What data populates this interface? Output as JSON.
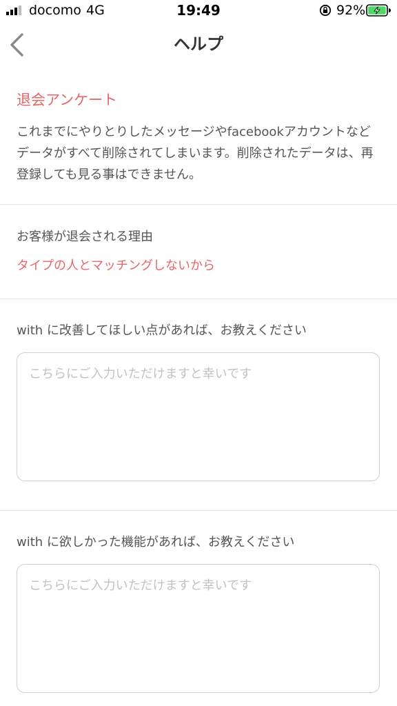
{
  "status_bar": {
    "carrier": "docomo",
    "network": "4G",
    "time": "19:49",
    "battery_percent": "92%",
    "icons": [
      "signal-bars-icon",
      "orientation-lock-icon",
      "battery-charging-icon"
    ],
    "battery_color": "#4cd964"
  },
  "nav": {
    "back_icon": "chevron-left-icon",
    "title": "ヘルプ"
  },
  "survey": {
    "title": "退会アンケート",
    "notice": "これまでにやりとりしたメッセージやfacebookアカウントなどデータがすべて削除されてしまいます。削除されたデータは、再登録しても見る事はできません。",
    "reason_label": "お客様が退会される理由",
    "reason_value": "タイプの人とマッチングしないから",
    "improvement_label": "with に改善してほしい点があれば、お教えください",
    "improvement_placeholder": "こちらにご入力いただけますと幸いです",
    "improvement_value": "",
    "feature_label": "with に欲しかった機能があれば、お教えください",
    "feature_placeholder": "こちらにご入力いただけますと幸いです",
    "feature_value": ""
  },
  "colors": {
    "accent": "#e8676b",
    "text": "#555555",
    "divider": "#e2e2e2",
    "placeholder": "#c2c2c2"
  }
}
